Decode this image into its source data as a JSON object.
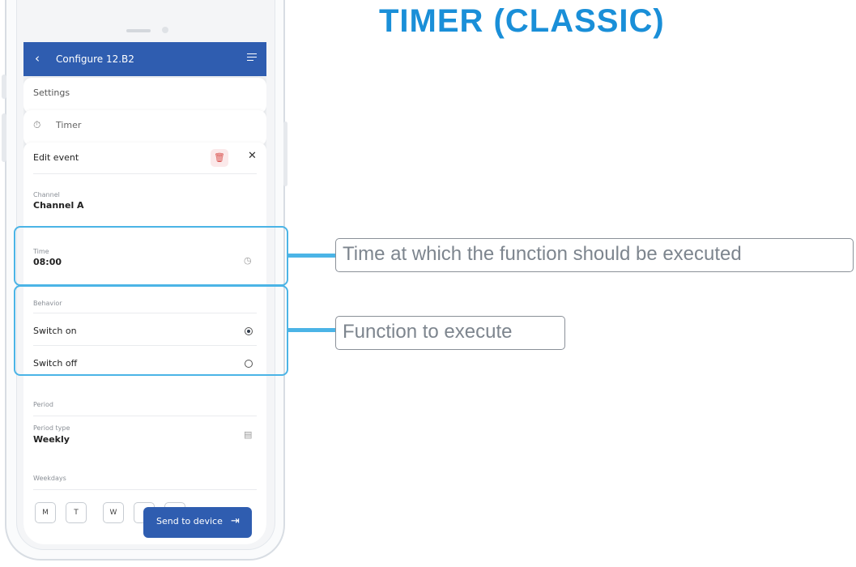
{
  "page_title": "TIMER (CLASSIC)",
  "app": {
    "header": {
      "back_icon": "chevron-left-icon",
      "title": "Configure 12.B2",
      "menu_icon": "sort-menu-icon"
    },
    "settings_label": "Settings",
    "timer_label": "Timer",
    "edit_event": {
      "title": "Edit event",
      "delete_icon": "trash-icon",
      "close_icon": "close-icon",
      "channel_label": "Channel",
      "channel_value": "Channel A",
      "time_label": "Time",
      "time_value": "08:00",
      "behavior_label": "Behavior",
      "options": [
        {
          "label": "Switch on",
          "selected": true
        },
        {
          "label": "Switch off",
          "selected": false
        }
      ],
      "period_label": "Period",
      "period_type_label": "Period type",
      "period_type_value": "Weekly",
      "weekdays_label": "Weekdays",
      "weekdays": [
        "M",
        "T",
        "W"
      ]
    },
    "send_button": "Send to device"
  },
  "callouts": {
    "time": "Time at which the function should be executed",
    "function": "Function to execute"
  },
  "colors": {
    "header": "#2f5db0",
    "highlight": "#4bb4e6",
    "title": "#1a8fd8"
  }
}
